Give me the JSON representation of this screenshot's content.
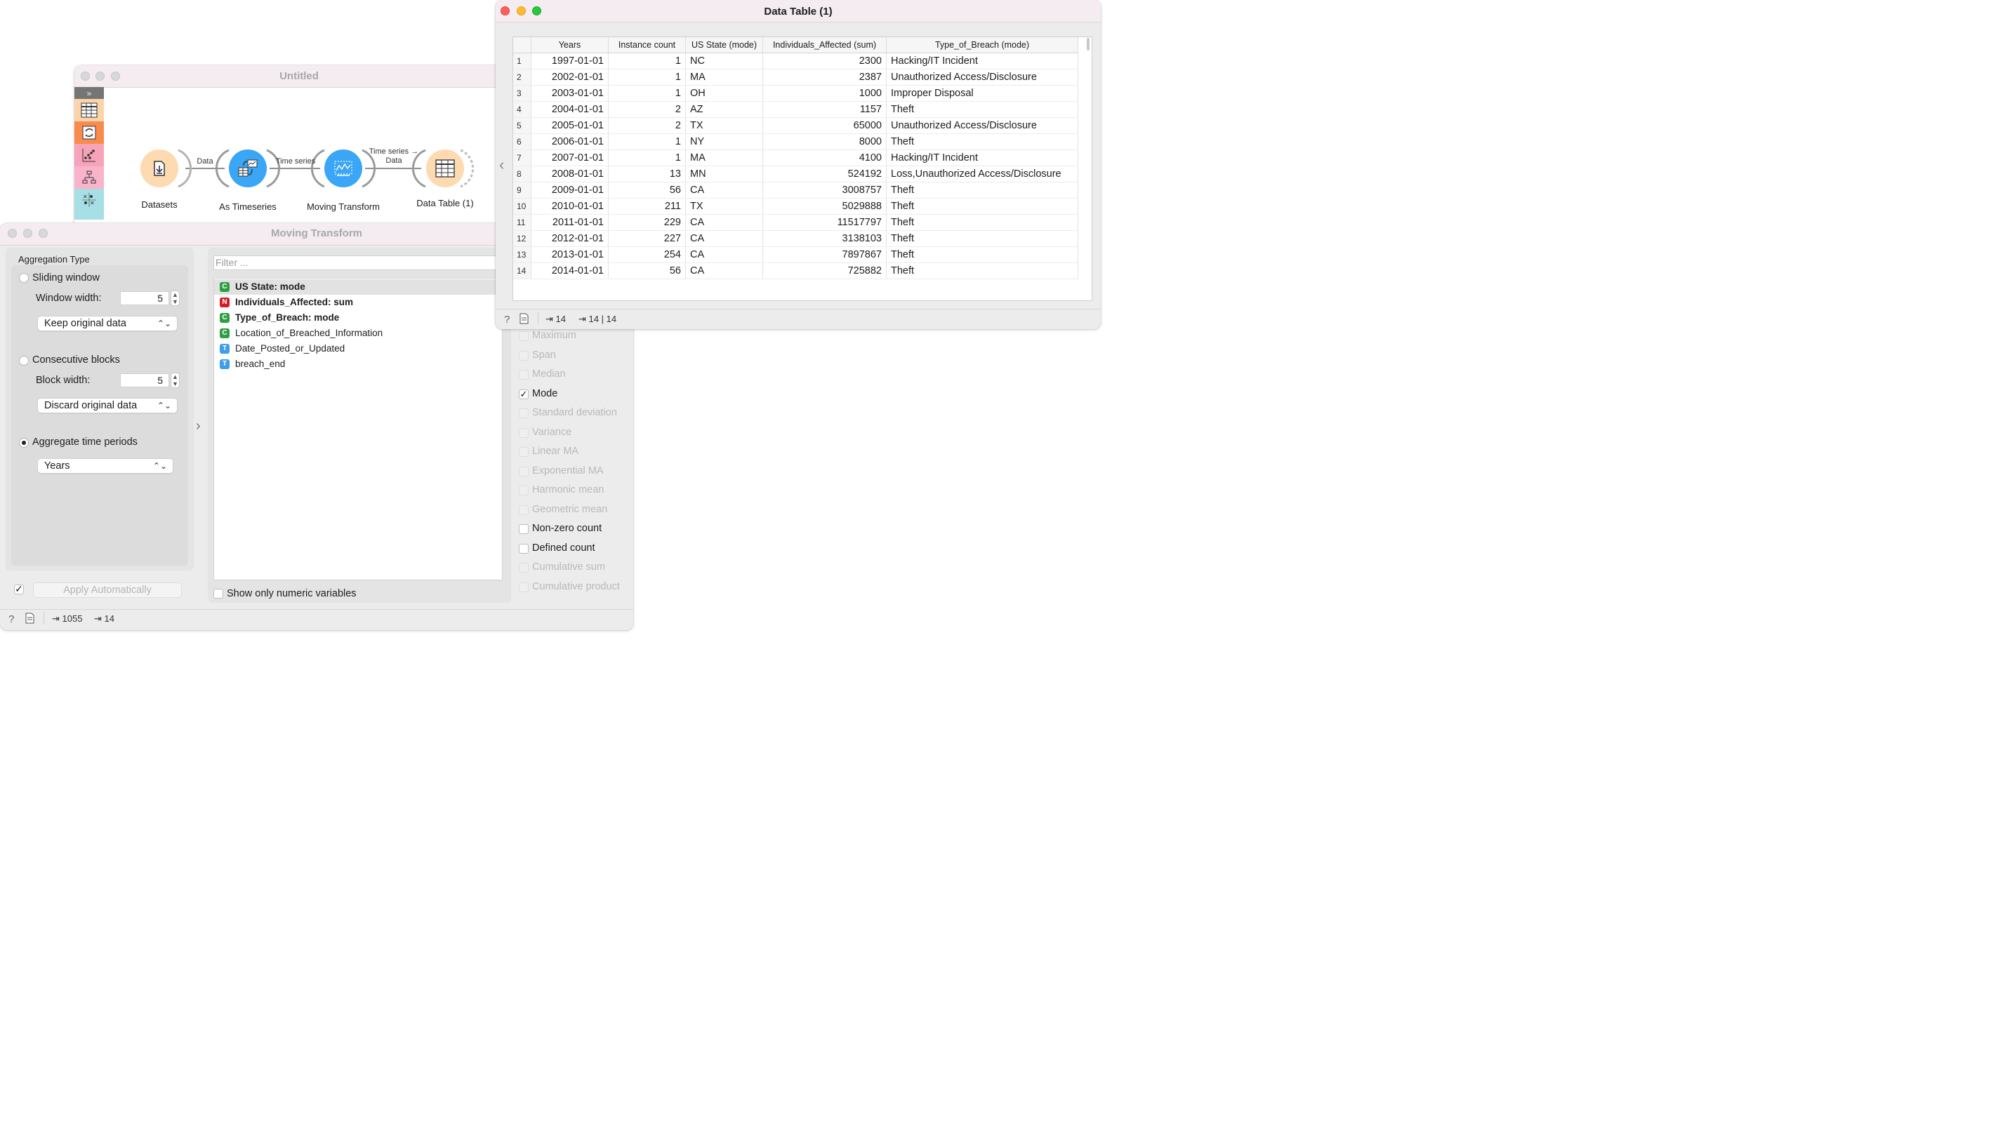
{
  "canvas_window": {
    "title": "Untitled",
    "toolbox_icons": [
      "expand-icon",
      "data-table-icon",
      "transform-icon",
      "scatter-plot-icon",
      "tree-icon",
      "sieve-diagram-icon",
      "scatter-icon"
    ],
    "nodes": [
      {
        "label": "Datasets"
      },
      {
        "label": "As Timeseries"
      },
      {
        "label": "Moving Transform"
      },
      {
        "label": "Data Table (1)"
      }
    ],
    "links": [
      {
        "label": "Data"
      },
      {
        "label": "Time series"
      },
      {
        "label_top": "Time series →",
        "label_bottom": "Data"
      }
    ]
  },
  "moving_transform": {
    "title": "Moving Transform",
    "aggregation_type_label": "Aggregation Type",
    "sliding_window": {
      "label": "Sliding window",
      "width_label": "Window width:",
      "width_value": "5",
      "mode": "Keep original data",
      "selected": false
    },
    "consecutive_blocks": {
      "label": "Consecutive blocks",
      "width_label": "Block width:",
      "width_value": "5",
      "mode": "Discard original data",
      "selected": false
    },
    "aggregate_time_periods": {
      "label": "Aggregate time periods",
      "period": "Years",
      "selected": true
    },
    "filter_placeholder": "Filter ...",
    "variables": [
      {
        "type": "C",
        "label": "US State: mode",
        "bold": true,
        "selected": true
      },
      {
        "type": "N",
        "label": "Individuals_Affected: sum",
        "bold": true,
        "selected": false
      },
      {
        "type": "C",
        "label": "Type_of_Breach: mode",
        "bold": true,
        "selected": false
      },
      {
        "type": "C",
        "label": "Location_of_Breached_Information",
        "bold": false,
        "selected": false
      },
      {
        "type": "T",
        "label": "Date_Posted_or_Updated",
        "bold": false,
        "selected": false
      },
      {
        "type": "T",
        "label": "breach_end",
        "bold": false,
        "selected": false
      }
    ],
    "aggregations": [
      {
        "label": "Maximum",
        "checked": false,
        "enabled": false
      },
      {
        "label": "Span",
        "checked": false,
        "enabled": false
      },
      {
        "label": "Median",
        "checked": false,
        "enabled": false
      },
      {
        "label": "Mode",
        "checked": true,
        "enabled": true
      },
      {
        "label": "Standard deviation",
        "checked": false,
        "enabled": false
      },
      {
        "label": "Variance",
        "checked": false,
        "enabled": false
      },
      {
        "label": "Linear MA",
        "checked": false,
        "enabled": false
      },
      {
        "label": "Exponential MA",
        "checked": false,
        "enabled": false
      },
      {
        "label": "Harmonic mean",
        "checked": false,
        "enabled": false
      },
      {
        "label": "Geometric mean",
        "checked": false,
        "enabled": false
      },
      {
        "label": "Non-zero count",
        "checked": false,
        "enabled": true
      },
      {
        "label": "Defined count",
        "checked": false,
        "enabled": true
      },
      {
        "label": "Cumulative sum",
        "checked": false,
        "enabled": false
      },
      {
        "label": "Cumulative product",
        "checked": false,
        "enabled": false
      }
    ],
    "show_numeric_label": "Show only numeric variables",
    "apply_label": "Apply Automatically",
    "apply_checked": true,
    "status": {
      "input_count": "1055",
      "output_count": "14"
    }
  },
  "data_table": {
    "title": "Data Table (1)",
    "columns": [
      "Years",
      "Instance count",
      "US State (mode)",
      "Individuals_Affected (sum)",
      "Type_of_Breach (mode)"
    ],
    "rows": [
      [
        "1",
        "1997-01-01",
        "1",
        "NC",
        "2300",
        "Hacking/IT Incident"
      ],
      [
        "2",
        "2002-01-01",
        "1",
        "MA",
        "2387",
        "Unauthorized Access/Disclosure"
      ],
      [
        "3",
        "2003-01-01",
        "1",
        "OH",
        "1000",
        "Improper Disposal"
      ],
      [
        "4",
        "2004-01-01",
        "2",
        "AZ",
        "1157",
        "Theft"
      ],
      [
        "5",
        "2005-01-01",
        "2",
        "TX",
        "65000",
        "Unauthorized Access/Disclosure"
      ],
      [
        "6",
        "2006-01-01",
        "1",
        "NY",
        "8000",
        "Theft"
      ],
      [
        "7",
        "2007-01-01",
        "1",
        "MA",
        "4100",
        "Hacking/IT Incident"
      ],
      [
        "8",
        "2008-01-01",
        "13",
        "MN",
        "524192",
        "Loss,Unauthorized Access/Disclosure"
      ],
      [
        "9",
        "2009-01-01",
        "56",
        "CA",
        "3008757",
        "Theft"
      ],
      [
        "10",
        "2010-01-01",
        "211",
        "TX",
        "5029888",
        "Theft"
      ],
      [
        "11",
        "2011-01-01",
        "229",
        "CA",
        "11517797",
        "Theft"
      ],
      [
        "12",
        "2012-01-01",
        "227",
        "CA",
        "3138103",
        "Theft"
      ],
      [
        "13",
        "2013-01-01",
        "254",
        "CA",
        "7897867",
        "Theft"
      ],
      [
        "14",
        "2014-01-01",
        "56",
        "CA",
        "725882",
        "Theft"
      ]
    ],
    "status": {
      "input_count": "14",
      "output_count": "14 | 14"
    }
  },
  "colors": {
    "node_orange": "#fddab0",
    "node_blue": "#3aa6f5",
    "var_categorical": "#2e9e46",
    "var_numeric": "#d01c25",
    "var_time": "#3d9ee9"
  }
}
